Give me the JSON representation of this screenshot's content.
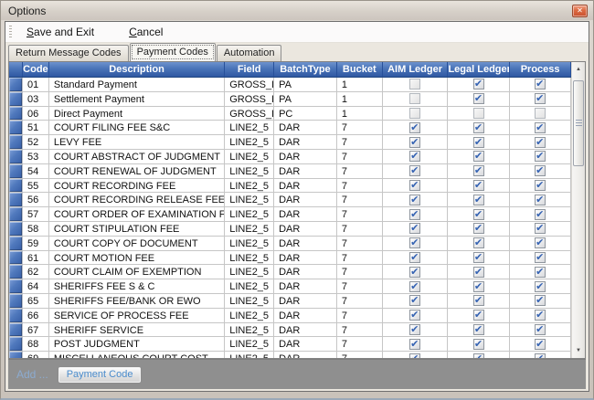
{
  "window": {
    "title": "Options"
  },
  "icons": {
    "close": "✕",
    "scroll_up": "▲",
    "scroll_down": "▼"
  },
  "menu": {
    "save_exit": "Save and Exit",
    "cancel": "Cancel"
  },
  "tabs": {
    "return_message_codes": "Return Message Codes",
    "payment_codes": "Payment Codes",
    "automation": "Automation",
    "active_tab": "Payment Codes"
  },
  "grid": {
    "columns": [
      "Code",
      "Description",
      "Field",
      "BatchType",
      "Bucket",
      "AIM Ledger",
      "Legal Ledger",
      "Process"
    ],
    "rows": [
      {
        "code": "01",
        "description": "Standard Payment",
        "field": "GROSS_PAY",
        "batch_type": "PA",
        "bucket": "1",
        "aim_ledger": false,
        "legal_ledger": true,
        "process": true
      },
      {
        "code": "03",
        "description": "Settlement Payment",
        "field": "GROSS_PAY",
        "batch_type": "PA",
        "bucket": "1",
        "aim_ledger": false,
        "legal_ledger": true,
        "process": true
      },
      {
        "code": "06",
        "description": "Direct Payment",
        "field": "GROSS_PAY",
        "batch_type": "PC",
        "bucket": "1",
        "aim_ledger": false,
        "legal_ledger": false,
        "process": false
      },
      {
        "code": "51",
        "description": "COURT FILING FEE S&C",
        "field": "LINE2_5",
        "batch_type": "DAR",
        "bucket": "7",
        "aim_ledger": true,
        "legal_ledger": true,
        "process": true
      },
      {
        "code": "52",
        "description": "LEVY FEE",
        "field": "LINE2_5",
        "batch_type": "DAR",
        "bucket": "7",
        "aim_ledger": true,
        "legal_ledger": true,
        "process": true
      },
      {
        "code": "53",
        "description": "COURT ABSTRACT OF JUDGMENT",
        "field": "LINE2_5",
        "batch_type": "DAR",
        "bucket": "7",
        "aim_ledger": true,
        "legal_ledger": true,
        "process": true
      },
      {
        "code": "54",
        "description": "COURT RENEWAL OF JUDGMENT",
        "field": "LINE2_5",
        "batch_type": "DAR",
        "bucket": "7",
        "aim_ledger": true,
        "legal_ledger": true,
        "process": true
      },
      {
        "code": "55",
        "description": "COURT RECORDING FEE",
        "field": "LINE2_5",
        "batch_type": "DAR",
        "bucket": "7",
        "aim_ledger": true,
        "legal_ledger": true,
        "process": true
      },
      {
        "code": "56",
        "description": "COURT RECORDING RELEASE FEE",
        "field": "LINE2_5",
        "batch_type": "DAR",
        "bucket": "7",
        "aim_ledger": true,
        "legal_ledger": true,
        "process": true
      },
      {
        "code": "57",
        "description": "COURT ORDER OF EXAMINATION FEE",
        "field": "LINE2_5",
        "batch_type": "DAR",
        "bucket": "7",
        "aim_ledger": true,
        "legal_ledger": true,
        "process": true
      },
      {
        "code": "58",
        "description": "COURT STIPULATION FEE",
        "field": "LINE2_5",
        "batch_type": "DAR",
        "bucket": "7",
        "aim_ledger": true,
        "legal_ledger": true,
        "process": true
      },
      {
        "code": "59",
        "description": "COURT COPY OF DOCUMENT",
        "field": "LINE2_5",
        "batch_type": "DAR",
        "bucket": "7",
        "aim_ledger": true,
        "legal_ledger": true,
        "process": true
      },
      {
        "code": "61",
        "description": "COURT MOTION FEE",
        "field": "LINE2_5",
        "batch_type": "DAR",
        "bucket": "7",
        "aim_ledger": true,
        "legal_ledger": true,
        "process": true
      },
      {
        "code": "62",
        "description": "COURT CLAIM OF EXEMPTION",
        "field": "LINE2_5",
        "batch_type": "DAR",
        "bucket": "7",
        "aim_ledger": true,
        "legal_ledger": true,
        "process": true
      },
      {
        "code": "64",
        "description": "SHERIFFS FEE S & C",
        "field": "LINE2_5",
        "batch_type": "DAR",
        "bucket": "7",
        "aim_ledger": true,
        "legal_ledger": true,
        "process": true
      },
      {
        "code": "65",
        "description": "SHERIFFS FEE/BANK OR EWO",
        "field": "LINE2_5",
        "batch_type": "DAR",
        "bucket": "7",
        "aim_ledger": true,
        "legal_ledger": true,
        "process": true
      },
      {
        "code": "66",
        "description": "SERVICE OF PROCESS FEE",
        "field": "LINE2_5",
        "batch_type": "DAR",
        "bucket": "7",
        "aim_ledger": true,
        "legal_ledger": true,
        "process": true
      },
      {
        "code": "67",
        "description": "SHERIFF SERVICE",
        "field": "LINE2_5",
        "batch_type": "DAR",
        "bucket": "7",
        "aim_ledger": true,
        "legal_ledger": true,
        "process": true
      },
      {
        "code": "68",
        "description": "POST JUDGMENT",
        "field": "LINE2_5",
        "batch_type": "DAR",
        "bucket": "7",
        "aim_ledger": true,
        "legal_ledger": true,
        "process": true
      },
      {
        "code": "69",
        "description": "MISCELLANEOUS COURT COST",
        "field": "LINE2_5",
        "batch_type": "DAR",
        "bucket": "7",
        "aim_ledger": true,
        "legal_ledger": true,
        "process": true
      }
    ]
  },
  "footer": {
    "add_label": "Add ...",
    "payment_code_button": "Payment Code"
  },
  "colors": {
    "header_blue_top": "#6d92cd",
    "header_blue_bottom": "#2f58a2",
    "check_blue": "#3462b2",
    "row_selector_blue": "#5079bd",
    "footer_gray": "#8f8f8f",
    "accent_link_blue": "#8cabd0",
    "button_text_blue": "#4a8ccc",
    "close_button_orange": "#db6a42"
  }
}
